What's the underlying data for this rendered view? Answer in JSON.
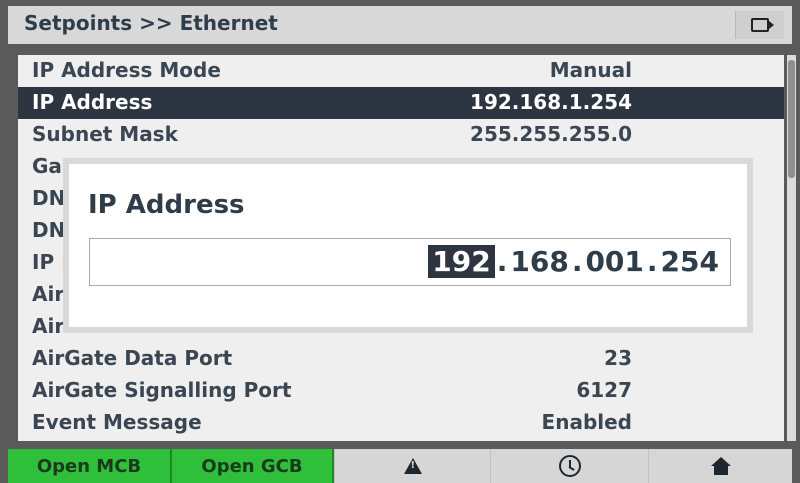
{
  "header": {
    "title": "Setpoints >> Ethernet",
    "camera_icon": "camera-icon"
  },
  "list": {
    "rows": [
      {
        "label": "IP Address Mode",
        "value": "Manual",
        "selected": false
      },
      {
        "label": "IP Address",
        "value": "192.168.1.254",
        "selected": true
      },
      {
        "label": "Subnet Mask",
        "value": "255.255.255.0",
        "selected": false
      },
      {
        "label": "Ga",
        "value": "",
        "selected": false
      },
      {
        "label": "DN",
        "value": "",
        "selected": false
      },
      {
        "label": "DN",
        "value": "",
        "selected": false
      },
      {
        "label": "IP I",
        "value": "",
        "selected": false
      },
      {
        "label": "Air",
        "value": "",
        "selected": false
      },
      {
        "label": "Air",
        "value": "",
        "selected": false
      },
      {
        "label": "AirGate Data Port",
        "value": "23",
        "selected": false
      },
      {
        "label": "AirGate Signalling Port",
        "value": "6127",
        "selected": false
      },
      {
        "label": "Event Message",
        "value": "Enabled",
        "selected": false
      }
    ]
  },
  "dialog": {
    "title": "IP Address",
    "ip_segments": [
      "192",
      "168",
      "001",
      "254"
    ],
    "active_segment": 0,
    "separator": "."
  },
  "bottom_bar": {
    "open_mcb_label": "Open MCB",
    "open_gcb_label": "Open GCB",
    "alarm_icon": "warning-icon",
    "history_icon": "history-icon",
    "home_icon": "home-icon"
  },
  "colors": {
    "selected_row": "#2d3540",
    "button_green": "#2fbf3a",
    "text_dark": "#3a4652"
  }
}
